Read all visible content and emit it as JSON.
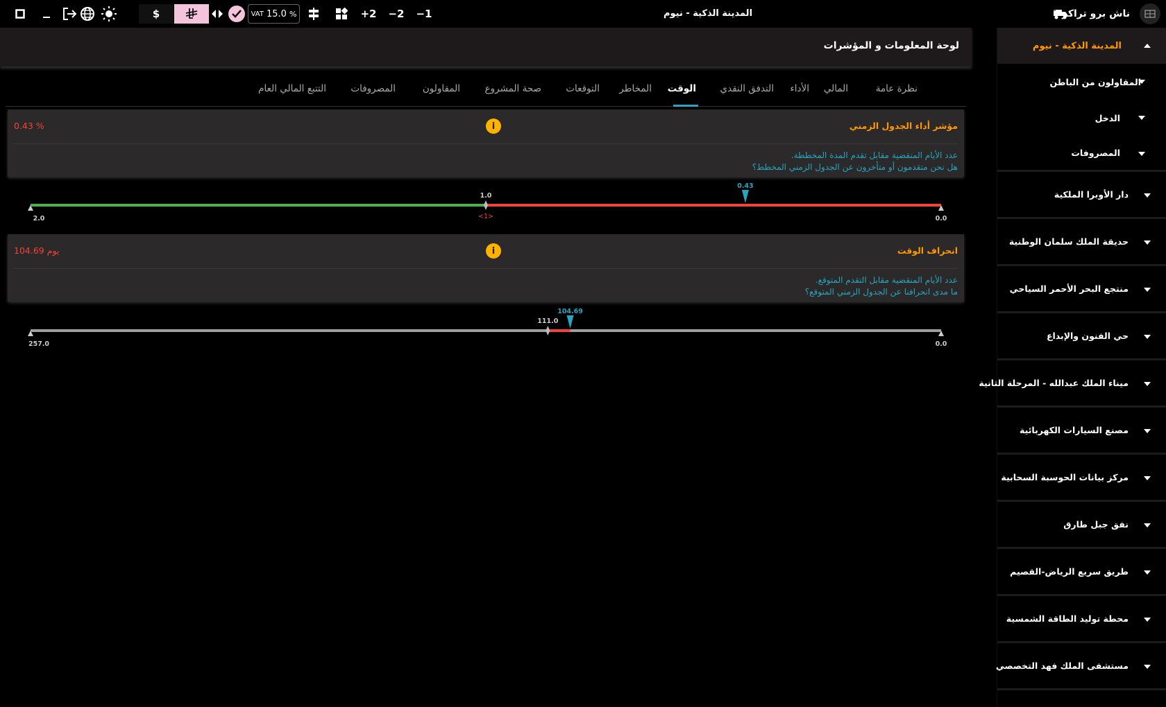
{
  "topbar": {
    "title": "المدينة الذكية - نيوم",
    "brand": "ناش برو تراكر",
    "vat_label": "VAT",
    "vat_value": "15.0",
    "vat_unit": "%",
    "currency_dollar": "$",
    "currency_riyal": "⃁",
    "step_plus2": "+2",
    "step_minus2": "−2",
    "step_minus1": "−1"
  },
  "panel": {
    "title": "لوحة المعلومات و المؤشرات"
  },
  "tabs": [
    {
      "label": "نظرة عامة",
      "active": false
    },
    {
      "label": "المالي",
      "active": false
    },
    {
      "label": "الأداء",
      "active": false
    },
    {
      "label": "التدفق النقدي",
      "active": false
    },
    {
      "label": "الوقت",
      "active": true
    },
    {
      "label": "المخاطر",
      "active": false
    },
    {
      "label": "التوقعات",
      "active": false
    },
    {
      "label": "صحة المشروع",
      "active": false
    },
    {
      "label": "المقاولون",
      "active": false
    },
    {
      "label": "المصروفات",
      "active": false
    },
    {
      "label": "التتبع المالي العام",
      "active": false
    }
  ],
  "kpis": [
    {
      "title": "مؤشر أداء الجدول الزمني",
      "value": "0.43 %",
      "desc1": "عدد الأيام المنقضية مقابل تقدم المدة المخططة.",
      "desc2": "هل نحن متقدمون أو متأخرون عن الجدول الزمني المخطط؟",
      "gauge": {
        "min_label": "0.0",
        "max_label": "2.0",
        "target_label": "1.0",
        "target_sub": "<1>",
        "marker_label": "0.43",
        "min": 0,
        "max": 2,
        "target": 1,
        "value": 0.43,
        "colors": {
          "good": "#4caf50",
          "bad": "#f44336",
          "marker": "#26a6c0"
        }
      }
    },
    {
      "title": "انحراف الوقت",
      "value": "104.69 يوم",
      "desc1": "عدد الأيام المنقضية مقابل التقدم المتوقع.",
      "desc2": "ما مدى انحرافنا عن الجدول الزمني المتوقع؟",
      "gauge": {
        "min_label": "0.0",
        "max_label": "257.0",
        "target_label": "111.0",
        "marker_label": "104.69",
        "min": 0,
        "max": 257,
        "target": 111,
        "value": 104.69,
        "colors": {
          "track": "#9e9e9e",
          "bad": "#f44336",
          "marker": "#26a6c0"
        }
      }
    }
  ],
  "sidebar": {
    "project": "المدينة الذكية - نيوم",
    "sub_items": [
      "المقاولون من الباطن",
      "الدخل",
      "المصروفات"
    ],
    "projects": [
      "دار الأوبرا الملكية",
      "حديقة الملك سلمان الوطنية",
      "منتجع البحر الأحمر السياحي",
      "حي الفنون والإبداع",
      "ميناء الملك عبدالله - المرحلة الثانية",
      "مصنع السيارات الكهربائية",
      "مركز بيانات الحوسبة السحابية",
      "نفق جبل طارق",
      "طريق سريع الرياض-القصيم",
      "محطة توليد الطاقة الشمسية",
      "مستشفى الملك فهد التخصصي"
    ]
  },
  "colors": {
    "accent": "#26a6c0",
    "orange": "#ff9800",
    "red": "#f44336",
    "pink": "#f4c3dc"
  }
}
